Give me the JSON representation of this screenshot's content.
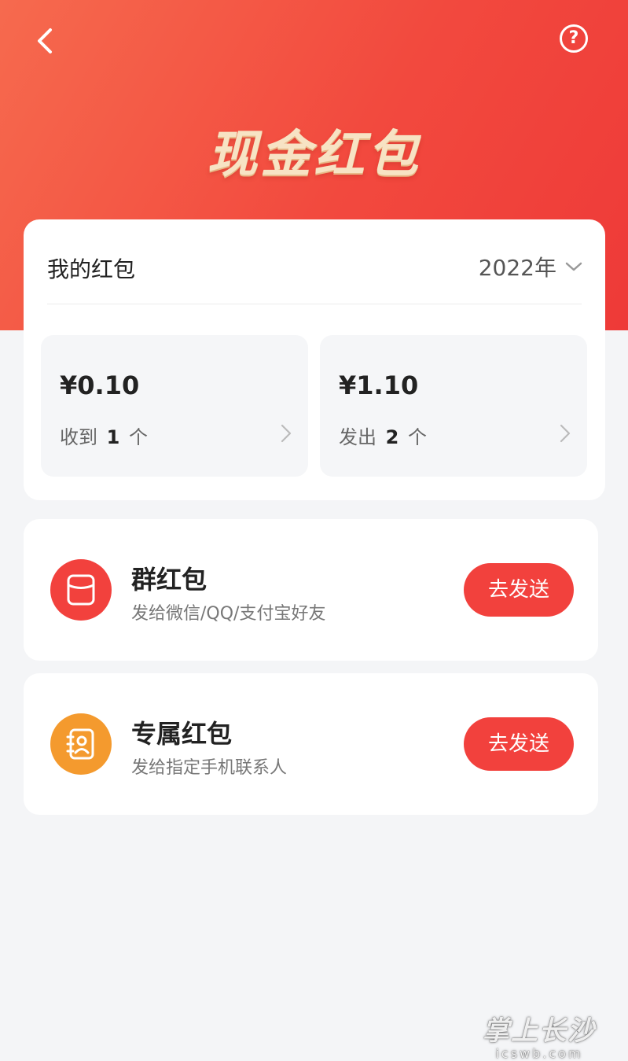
{
  "header": {
    "title": "现金红包",
    "back_icon": "chevron-left-icon",
    "help_icon": "question-circle-icon"
  },
  "summary": {
    "label": "我的红包",
    "year": "2022年",
    "received": {
      "amount": "¥0.10",
      "prefix": "收到",
      "count": "1",
      "unit": "个"
    },
    "sent": {
      "amount": "¥1.10",
      "prefix": "发出",
      "count": "2",
      "unit": "个"
    }
  },
  "options": [
    {
      "title": "群红包",
      "subtitle": "发给微信/QQ/支付宝好友",
      "button": "去发送",
      "icon": "red-packet-icon",
      "color": "#f2413d"
    },
    {
      "title": "专属红包",
      "subtitle": "发给指定手机联系人",
      "button": "去发送",
      "icon": "contact-card-icon",
      "color": "#f49a2e"
    }
  ],
  "watermark": {
    "main": "掌上长沙",
    "sub": "icswb.com"
  },
  "colors": {
    "accent": "#f2413d",
    "header_start": "#f66a4e",
    "header_end": "#ee3a38",
    "title_gold": "#f7e3c4"
  }
}
